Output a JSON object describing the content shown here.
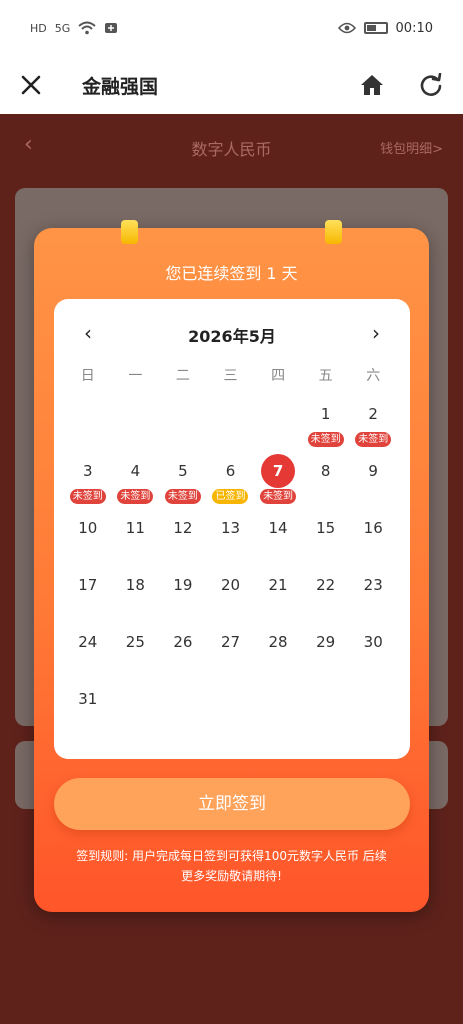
{
  "status_bar": {
    "network": "HD",
    "signal": "5G",
    "time": "00:10"
  },
  "topnav": {
    "title": "金融强国"
  },
  "background_page": {
    "title": "数字人民币",
    "right_link": "钱包明细>"
  },
  "modal": {
    "streak_text": "您已连续签到 1 天",
    "calendar": {
      "month_label": "2026年5月",
      "prev": "‹",
      "next": "›",
      "weekdays": [
        "日",
        "一",
        "二",
        "三",
        "四",
        "五",
        "六"
      ],
      "leading_blanks": 5,
      "days": [
        {
          "d": "1",
          "tag": "未签到"
        },
        {
          "d": "2",
          "tag": "未签到"
        },
        {
          "d": "3",
          "tag": "未签到"
        },
        {
          "d": "4",
          "tag": "未签到"
        },
        {
          "d": "5",
          "tag": "未签到"
        },
        {
          "d": "6",
          "tag": "已签到",
          "done": true
        },
        {
          "d": "7",
          "tag": "未签到",
          "today": true
        },
        {
          "d": "8"
        },
        {
          "d": "9"
        },
        {
          "d": "10"
        },
        {
          "d": "11"
        },
        {
          "d": "12"
        },
        {
          "d": "13"
        },
        {
          "d": "14"
        },
        {
          "d": "15"
        },
        {
          "d": "16"
        },
        {
          "d": "17"
        },
        {
          "d": "18"
        },
        {
          "d": "19"
        },
        {
          "d": "20"
        },
        {
          "d": "21"
        },
        {
          "d": "22"
        },
        {
          "d": "23"
        },
        {
          "d": "24"
        },
        {
          "d": "25"
        },
        {
          "d": "26"
        },
        {
          "d": "27"
        },
        {
          "d": "28"
        },
        {
          "d": "29"
        },
        {
          "d": "30"
        },
        {
          "d": "31"
        }
      ]
    },
    "button_label": "立即签到",
    "rule_line1": "签到规则: 用户完成每日签到可获得100元数字人民币 后续",
    "rule_line2": "更多奖励敬请期待!"
  },
  "colors": {
    "accent_red": "#e53935",
    "tag_unsigned": "#e0433b",
    "tag_signed": "#f7b500",
    "modal_top": "#ff9446",
    "modal_bottom": "#ff552a"
  }
}
